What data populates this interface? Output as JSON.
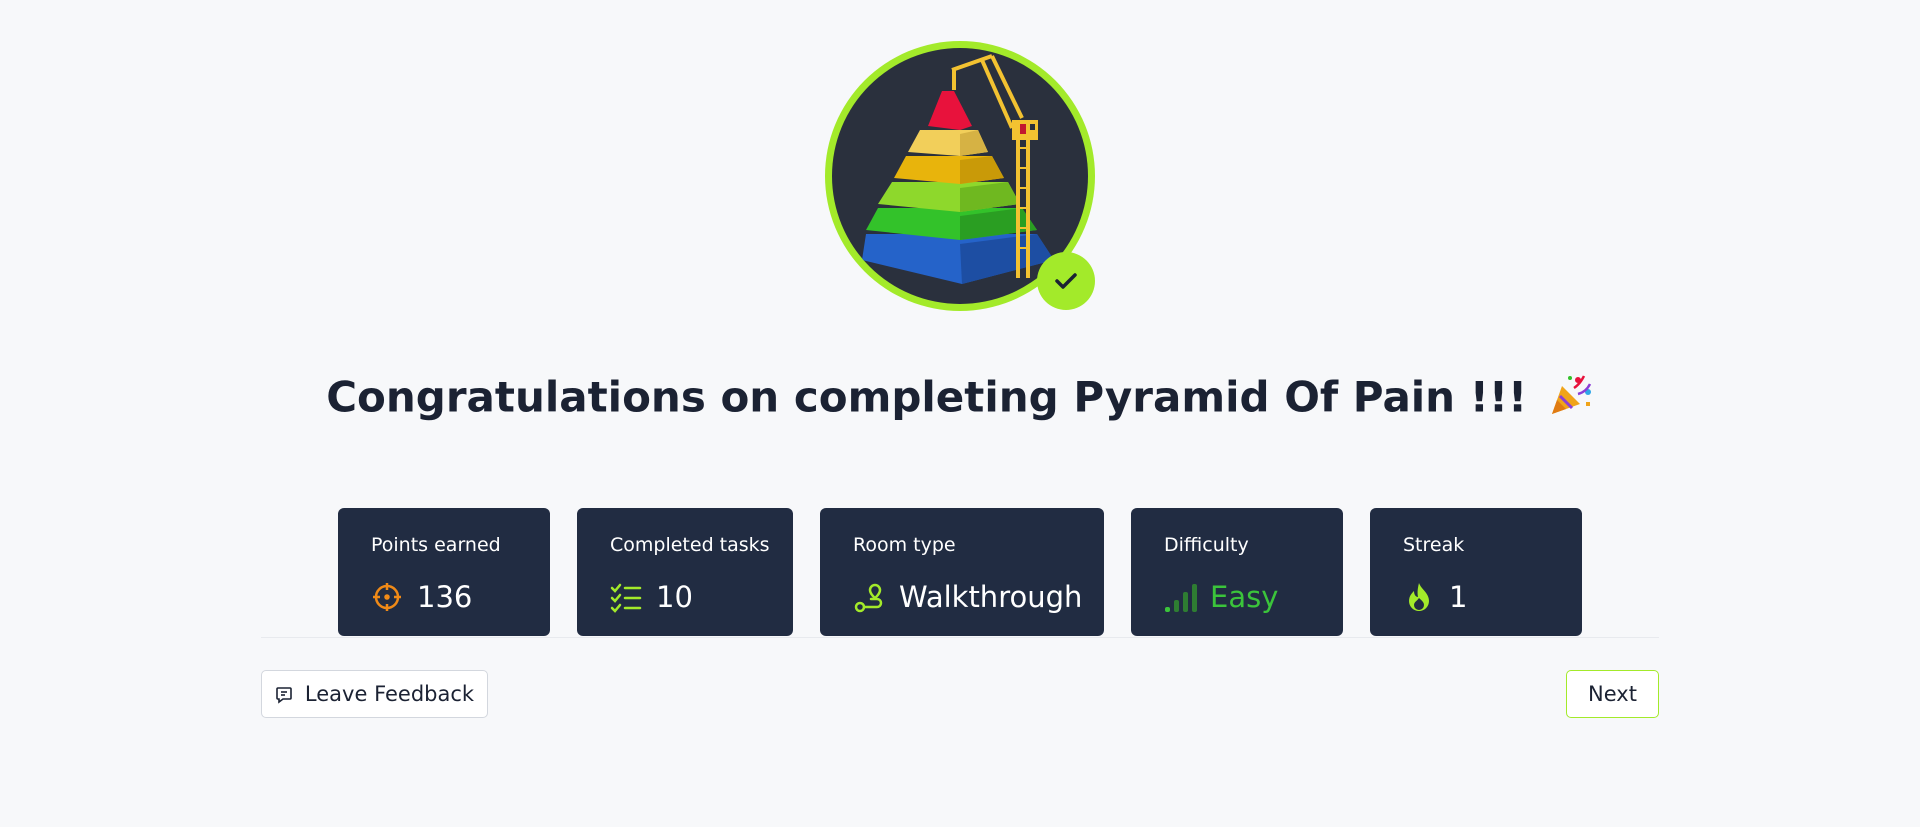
{
  "badge": {
    "room_name": "Pyramid Of Pain",
    "completed": true,
    "ring_color": "#a3ea2a",
    "icon": "pyramid-crane-icon"
  },
  "title": {
    "text": "Congratulations on completing Pyramid Of Pain !!!",
    "emoji": "🎉"
  },
  "stats": [
    {
      "label": "Points earned",
      "value": "136",
      "icon": "target-icon",
      "icon_color": "#f08a17"
    },
    {
      "label": "Completed tasks",
      "value": "10",
      "icon": "checklist-icon",
      "icon_color": "#a3ea2a"
    },
    {
      "label": "Room type",
      "value": "Walkthrough",
      "icon": "route-icon",
      "icon_color": "#a3ea2a"
    },
    {
      "label": "Difficulty",
      "value": "Easy",
      "icon": "signal-bars-icon",
      "icon_color": "#3bc43b"
    },
    {
      "label": "Streak",
      "value": "1",
      "icon": "flame-icon",
      "icon_color": "#a3ea2a"
    }
  ],
  "actions": {
    "feedback_label": "Leave Feedback",
    "next_label": "Next"
  },
  "colors": {
    "background": "#f7f8fa",
    "card": "#212c42",
    "accent": "#a3ea2a",
    "easy": "#3bc43b",
    "points_icon": "#f08a17"
  }
}
